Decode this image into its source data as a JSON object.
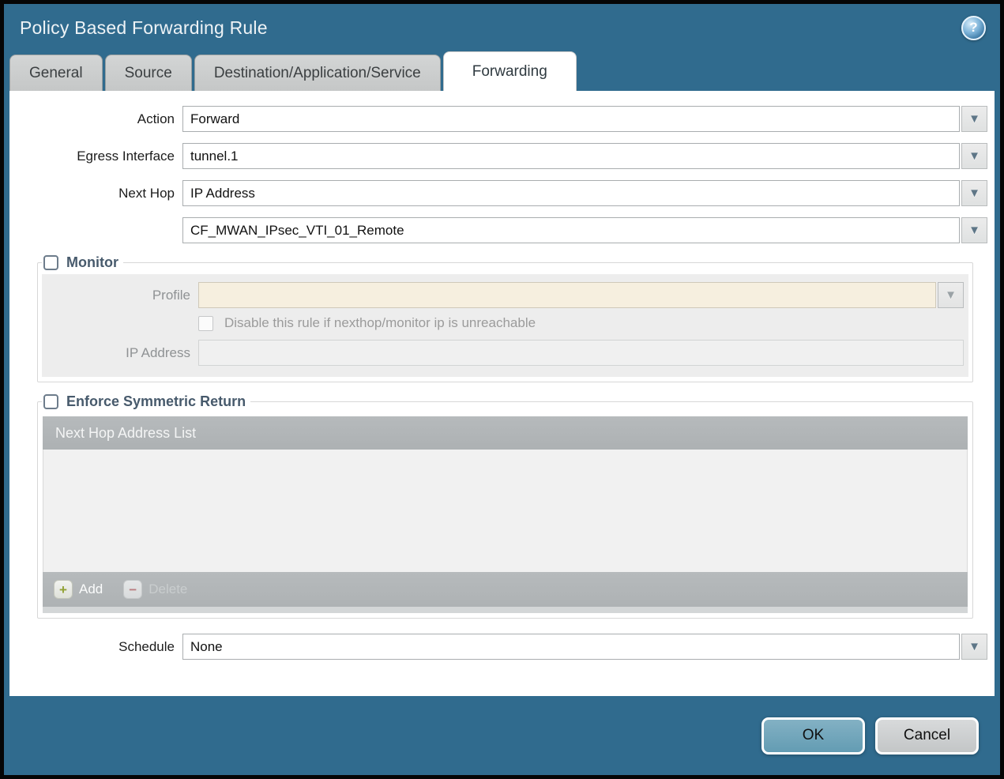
{
  "window": {
    "title": "Policy Based Forwarding Rule"
  },
  "tabs": [
    {
      "label": "General",
      "active": false
    },
    {
      "label": "Source",
      "active": false
    },
    {
      "label": "Destination/Application/Service",
      "active": false
    },
    {
      "label": "Forwarding",
      "active": true
    }
  ],
  "form": {
    "action_label": "Action",
    "action_value": "Forward",
    "egress_label": "Egress Interface",
    "egress_value": "tunnel.1",
    "next_hop_label": "Next Hop",
    "next_hop_value": "IP Address",
    "next_hop_address_value": "CF_MWAN_IPsec_VTI_01_Remote",
    "schedule_label": "Schedule",
    "schedule_value": "None"
  },
  "monitor": {
    "legend": "Monitor",
    "checked": false,
    "profile_label": "Profile",
    "profile_value": "",
    "disable_checkbox_label": "Disable this rule if nexthop/monitor ip is unreachable",
    "disable_checked": false,
    "ip_address_label": "IP Address",
    "ip_address_value": ""
  },
  "symmetric_return": {
    "legend": "Enforce Symmetric Return",
    "checked": false,
    "list_header": "Next Hop Address List",
    "add_label": "Add",
    "delete_label": "Delete"
  },
  "actions": {
    "ok_label": "OK",
    "cancel_label": "Cancel"
  },
  "icons": {
    "help": "?",
    "dropdown": "▼",
    "add": "+",
    "delete": "−"
  },
  "colors": {
    "titlebar": "#306b8e",
    "active_tab": "#ffffff",
    "inactive_tab": "#c9cbcb",
    "ok_button": "#6ba3ba",
    "cancel_button": "#cdd0d1",
    "disabled_profile_field": "#f6efdf",
    "table_header_bar": "#b1b5b7",
    "add_icon_plus": "#91a132",
    "delete_icon_minus": "#bb7277"
  }
}
